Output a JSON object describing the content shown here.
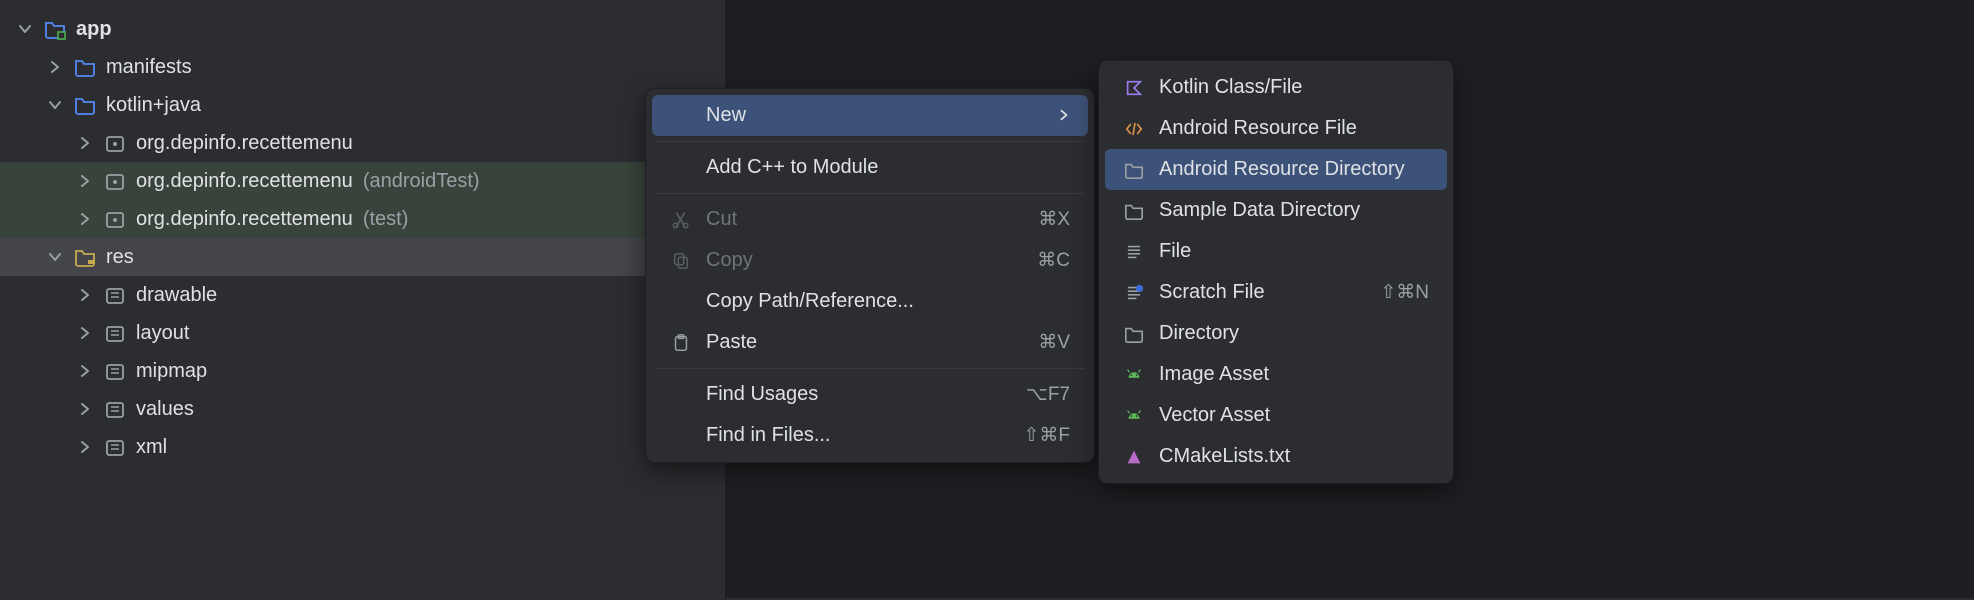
{
  "tree": {
    "root": {
      "label": "app"
    },
    "items": [
      {
        "label": "manifests"
      },
      {
        "label": "kotlin+java"
      },
      {
        "pkg": "org.depinfo.recettemenu",
        "suffix": ""
      },
      {
        "pkg": "org.depinfo.recettemenu",
        "suffix": "(androidTest)"
      },
      {
        "pkg": "org.depinfo.recettemenu",
        "suffix": "(test)"
      },
      {
        "label": "res"
      },
      {
        "label": "drawable"
      },
      {
        "label": "layout"
      },
      {
        "label": "mipmap"
      },
      {
        "label": "values"
      },
      {
        "label": "xml"
      }
    ]
  },
  "contextMenu": {
    "items": [
      {
        "label": "New"
      },
      {
        "label": "Add C++ to Module"
      },
      {
        "label": "Cut",
        "shortcut": "⌘X"
      },
      {
        "label": "Copy",
        "shortcut": "⌘C"
      },
      {
        "label": "Copy Path/Reference..."
      },
      {
        "label": "Paste",
        "shortcut": "⌘V"
      },
      {
        "label": "Find Usages",
        "shortcut": "⌥F7"
      },
      {
        "label": "Find in Files...",
        "shortcut": "⇧⌘F"
      }
    ]
  },
  "subMenu": {
    "items": [
      {
        "label": "Kotlin Class/File"
      },
      {
        "label": "Android Resource File"
      },
      {
        "label": "Android Resource Directory"
      },
      {
        "label": "Sample Data Directory"
      },
      {
        "label": "File"
      },
      {
        "label": "Scratch File",
        "shortcut": "⇧⌘N"
      },
      {
        "label": "Directory"
      },
      {
        "label": "Image Asset"
      },
      {
        "label": "Vector Asset"
      },
      {
        "label": "CMakeLists.txt"
      }
    ]
  }
}
